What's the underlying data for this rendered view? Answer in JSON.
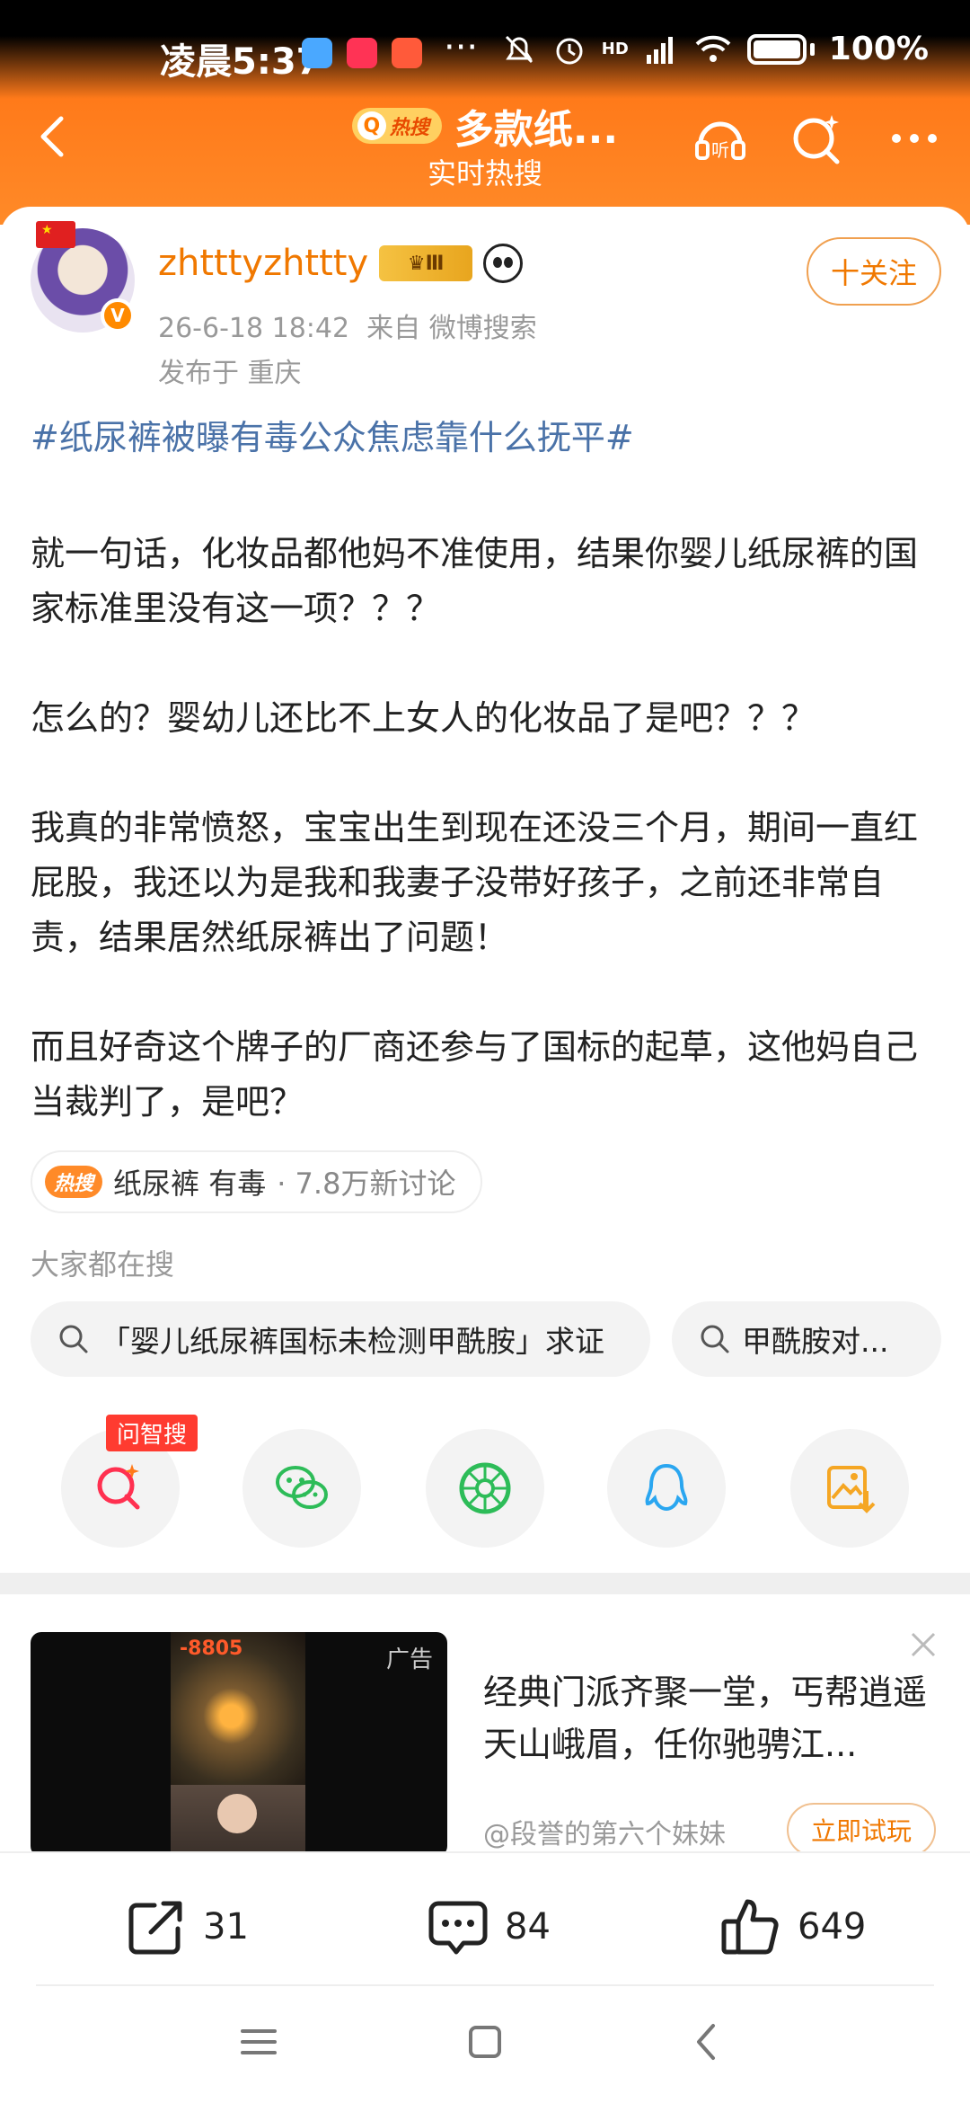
{
  "status_bar": {
    "time": "凌晨5:37",
    "more": "···",
    "network": "HD",
    "battery": "100%"
  },
  "nav": {
    "hot_tag": "热搜",
    "title": "多款纸...",
    "subtitle": "实时热搜",
    "icons": [
      "back-arrow-icon",
      "listen-icon",
      "sparkle-search-icon",
      "more-icon"
    ]
  },
  "post": {
    "username": "zhtttyzhttty",
    "level": "Ⅲ",
    "timestamp": "26-6-18 18:42",
    "source": "来自 微博搜索",
    "location": "发布于 重庆",
    "follow_label": "十关注",
    "topic": "#纸尿裤被曝有毒公众焦虑靠什么抚平#",
    "paragraphs": [
      "就一句话，化妆品都他妈不准使用，结果你婴儿纸尿裤的国家标准里没有这一项？？？",
      "怎么的？婴幼儿还比不上女人的化妆品了是吧？？？",
      "我真的非常愤怒，宝宝出生到现在还没三个月，期间一直红屁股，我还以为是我和我妻子没带好孩子，之前还非常自责，结果居然纸尿裤出了问题！",
      "而且好奇这个牌子的厂商还参与了国标的起草，这他妈自己当裁判了，是吧？"
    ]
  },
  "hot_chip": {
    "tag": "热搜",
    "keywords": "纸尿裤 有毒",
    "discussion": "· 7.8万新讨论"
  },
  "search": {
    "label": "大家都在搜",
    "items": [
      "「婴儿纸尿裤国标未检测甲酰胺」求证",
      "甲酰胺对..."
    ]
  },
  "share": {
    "ai_tag": "问智搜",
    "targets": [
      "ai-search-icon",
      "wechat-icon",
      "moments-icon",
      "qq-icon",
      "save-image-icon"
    ]
  },
  "ad": {
    "label": "广告",
    "score": "-8805",
    "text": "经典门派齐聚一堂，丐帮逍遥天山峨眉，任你驰骋江...",
    "author": "@段誉的第六个妹妹",
    "cta": "立即试玩"
  },
  "actions": {
    "reposts": "31",
    "comments": "84",
    "likes": "649"
  },
  "colors": {
    "brand_orange": "#ff7a1a",
    "link_blue": "#4a72a8",
    "username_orange": "#f07800"
  }
}
